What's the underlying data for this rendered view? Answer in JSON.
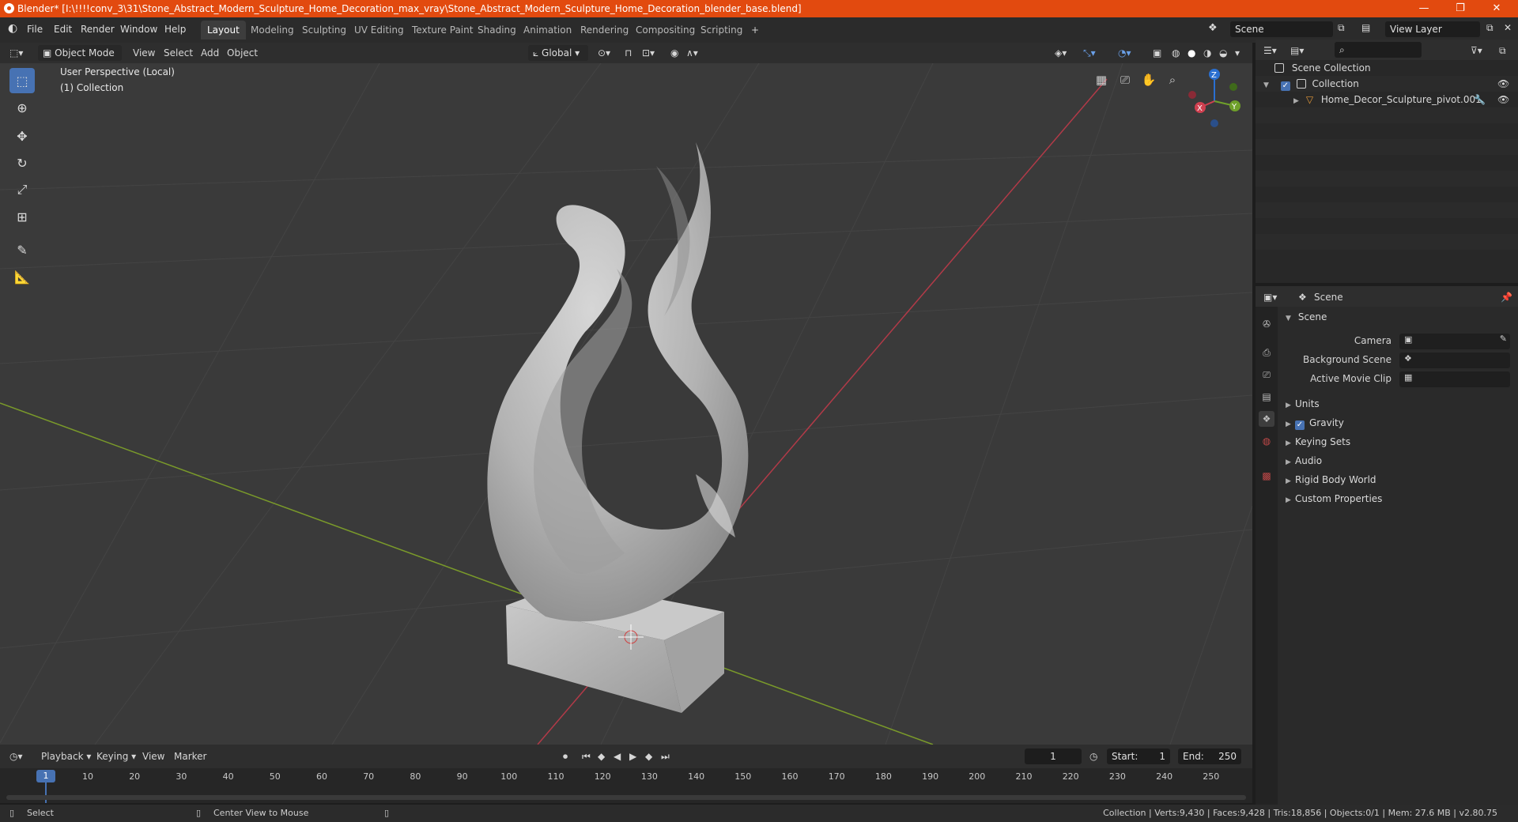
{
  "window": {
    "title": "Blender* [I:\\!!!!conv_3\\31\\Stone_Abstract_Modern_Sculpture_Home_Decoration_max_vray\\Stone_Abstract_Modern_Sculpture_Home_Decoration_blender_base.blend]",
    "minimize": "—",
    "maximize": "❐",
    "close": "✕"
  },
  "menu": {
    "items": [
      "File",
      "Edit",
      "Render",
      "Window",
      "Help"
    ],
    "workspaces": [
      "Layout",
      "Modeling",
      "Sculpting",
      "UV Editing",
      "Texture Paint",
      "Shading",
      "Animation",
      "Rendering",
      "Compositing",
      "Scripting"
    ],
    "active_workspace": "Layout",
    "add_tab": "+",
    "scene_name": "Scene",
    "view_layer": "View Layer"
  },
  "viewport_header": {
    "mode": "Object Mode",
    "items": [
      "View",
      "Select",
      "Add",
      "Object"
    ],
    "transform_orientation": "Global"
  },
  "viewport": {
    "perspective_label": "User Perspective (Local)",
    "collection_label": "(1) Collection",
    "background": "#3a3a3a",
    "axis_x": "X",
    "axis_y": "Y",
    "axis_z": "Z"
  },
  "timeline": {
    "menus": [
      "Playback",
      "Keying",
      "View",
      "Marker"
    ],
    "current_frame": "1",
    "start_label": "Start:",
    "start": "1",
    "end_label": "End:",
    "end": "250",
    "ticks": [
      "10",
      "20",
      "30",
      "40",
      "50",
      "60",
      "70",
      "80",
      "90",
      "100",
      "110",
      "120",
      "130",
      "140",
      "150",
      "160",
      "170",
      "180",
      "190",
      "200",
      "210",
      "220",
      "230",
      "240",
      "250"
    ],
    "playhead": "1"
  },
  "outliner": {
    "rows": [
      {
        "label": "Scene Collection"
      },
      {
        "label": "Collection"
      },
      {
        "label": "Home_Decor_Sculpture_pivot.001"
      }
    ]
  },
  "properties": {
    "header_title": "Scene",
    "panel_title": "Scene",
    "fields": [
      {
        "label": "Camera"
      },
      {
        "label": "Background Scene"
      },
      {
        "label": "Active Movie Clip"
      }
    ],
    "sections": [
      "Units",
      "Gravity",
      "Keying Sets",
      "Audio",
      "Rigid Body World",
      "Custom Properties"
    ]
  },
  "statusbar": {
    "left_action": "Select",
    "mid_action": "Center View to Mouse",
    "stats": "Collection | Verts:9,430 | Faces:9,428 | Tris:18,856 | Objects:0/1 | Mem: 27.6 MB | v2.80.75"
  },
  "colors": {
    "accent": "#4772b3",
    "title_bar": "#e24a0f",
    "axis_x_line": "#b23a48",
    "axis_y_line": "#7a9a2a"
  }
}
